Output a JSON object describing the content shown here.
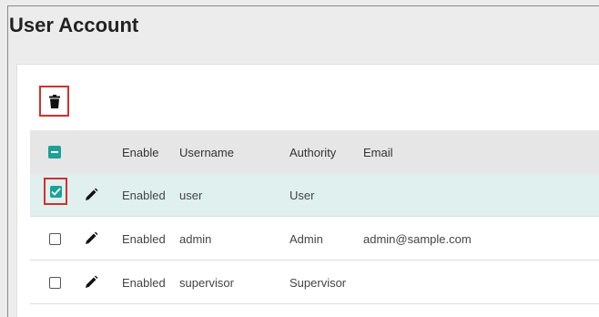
{
  "page": {
    "title": "User Account"
  },
  "toolbar": {
    "delete_icon": "trash-icon"
  },
  "table": {
    "headers": {
      "enable": "Enable",
      "username": "Username",
      "authority": "Authority",
      "email": "Email"
    },
    "rows": [
      {
        "enable": "Enabled",
        "username": "user",
        "authority": "User",
        "email": "",
        "checked": true
      },
      {
        "enable": "Enabled",
        "username": "admin",
        "authority": "Admin",
        "email": "admin@sample.com",
        "checked": false
      },
      {
        "enable": "Enabled",
        "username": "supervisor",
        "authority": "Supervisor",
        "email": "",
        "checked": false
      }
    ]
  },
  "colors": {
    "accent": "#1ea097",
    "highlight": "#d32f2f",
    "selected_row": "#dff0ee"
  }
}
